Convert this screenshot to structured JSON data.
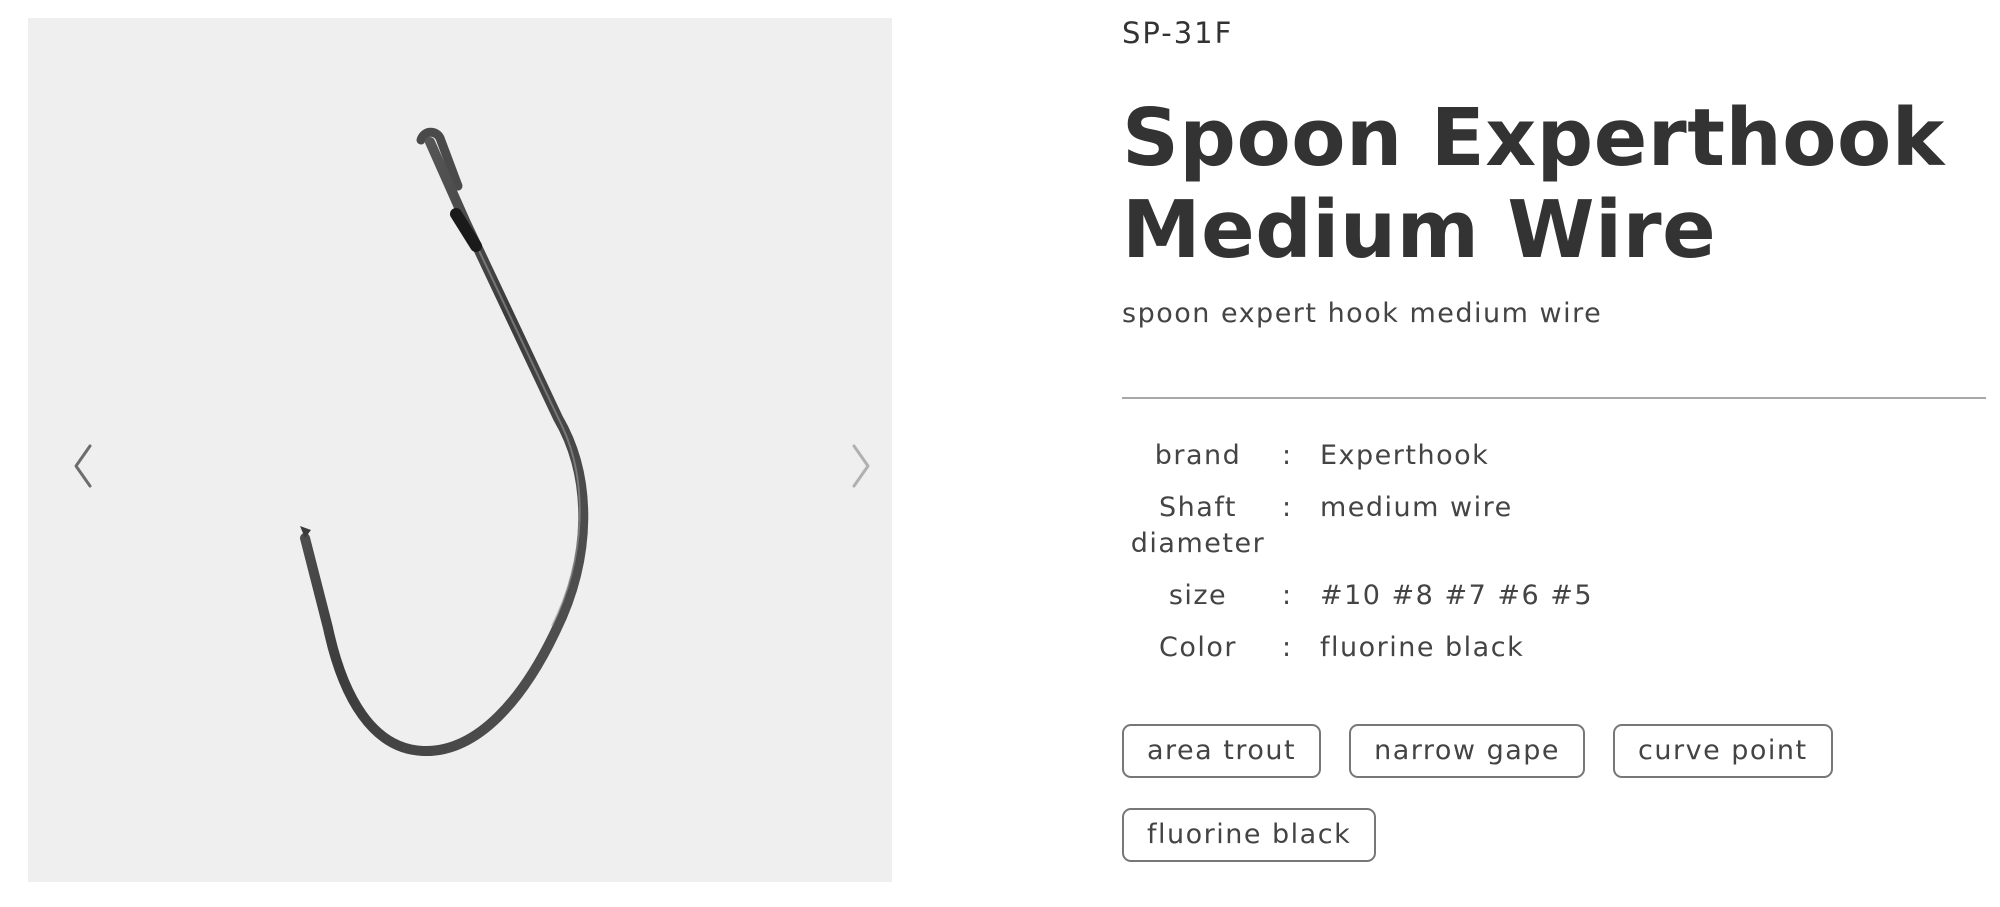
{
  "product": {
    "code": "SP-31F",
    "title": "Spoon Experthook Medium Wire",
    "subtitle": "spoon expert hook medium wire"
  },
  "gallery": {
    "prev_icon": "chevron-left-icon",
    "next_icon": "chevron-right-icon",
    "image": "fishing-hook-image"
  },
  "specs": [
    {
      "label": "brand",
      "separator": ":",
      "value": "Experthook"
    },
    {
      "label": "Shaft diameter",
      "separator": ":",
      "value": "medium wire"
    },
    {
      "label": "size",
      "separator": ":",
      "value": "#10 #8 #7 #6 #5"
    },
    {
      "label": "Color",
      "separator": ":",
      "value": "fluorine black"
    }
  ],
  "tags": [
    "area trout",
    "narrow gape",
    "curve point",
    "fluorine black"
  ],
  "colors": {
    "gallery_background": "#efefef",
    "text": "#333333",
    "divider": "#a8a8a8",
    "tag_border": "#777777"
  }
}
